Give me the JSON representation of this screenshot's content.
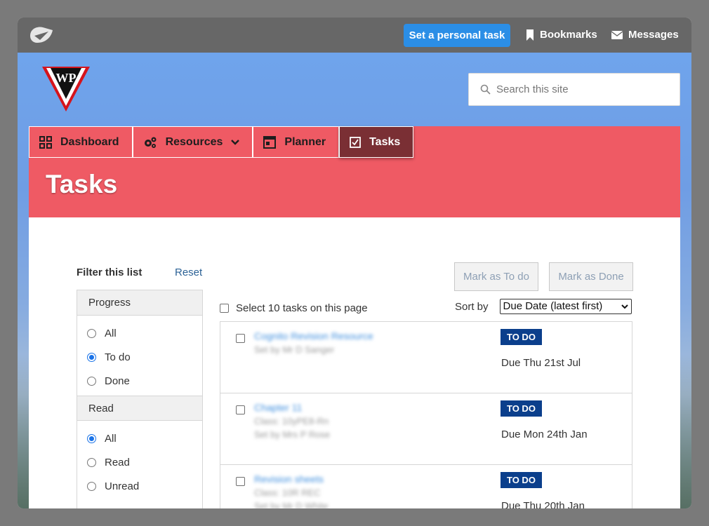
{
  "topbar": {
    "personal_task_label": "Set a personal task",
    "bookmarks_label": "Bookmarks",
    "messages_label": "Messages"
  },
  "brand": {
    "logo_text": "WP"
  },
  "search": {
    "placeholder": "Search this site"
  },
  "nav": {
    "items": [
      {
        "label": "Dashboard",
        "icon": "grid-icon"
      },
      {
        "label": "Resources",
        "icon": "gears-icon"
      },
      {
        "label": "Planner",
        "icon": "calendar-icon"
      },
      {
        "label": "Tasks",
        "icon": "checkbox-icon"
      }
    ]
  },
  "page": {
    "title": "Tasks"
  },
  "filter": {
    "title": "Filter this list",
    "reset_label": "Reset",
    "progress": {
      "title": "Progress",
      "options": [
        "All",
        "To do",
        "Done"
      ],
      "selected": "To do"
    },
    "read": {
      "title": "Read",
      "options": [
        "All",
        "Read",
        "Unread"
      ],
      "selected": "All"
    }
  },
  "actions": {
    "mark_todo_label": "Mark as To do",
    "mark_done_label": "Mark as Done",
    "select_all_label": "Select 10 tasks on this page",
    "sort_label": "Sort by",
    "sort_value": "Due Date (latest first)"
  },
  "tasks": [
    {
      "title": "Cognito Revision Resource",
      "lines": [
        "Set by Mr D Sanger"
      ],
      "status": "TO DO",
      "due": "Due Thu 21st Jul"
    },
    {
      "title": "Chapter 11",
      "lines": [
        "Class: 10yPE8-Rn",
        "Set by Mrs P Rose"
      ],
      "status": "TO DO",
      "due": "Due Mon 24th Jan"
    },
    {
      "title": "Revision sheets",
      "lines": [
        "Class: 10R REC",
        "Set by Mr D White"
      ],
      "status": "TO DO",
      "due": "Due Thu 20th Jan"
    }
  ],
  "colors": {
    "accent_red": "#ef5a64",
    "active_tab": "#7a2f34",
    "primary_blue": "#2b8ee6",
    "badge_navy": "#0b3f8c"
  }
}
